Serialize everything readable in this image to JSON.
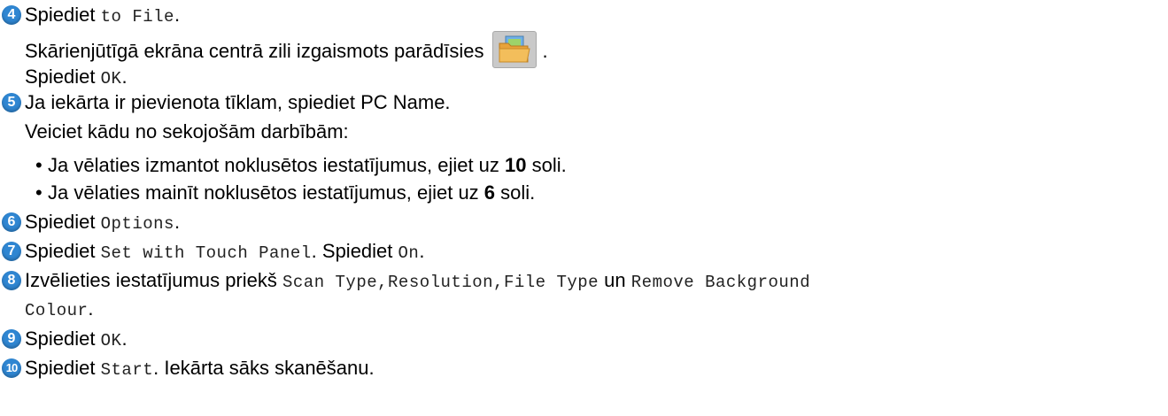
{
  "steps": [
    {
      "num": "4",
      "pre": "Spiediet ",
      "code": "to File",
      "post": "."
    },
    {
      "line2": "Skārienjūtīgā ekrāna centrā zili izgaismots parādīsies",
      "line2_end": ".",
      "icon": "folder-photo-icon"
    },
    {
      "line3_pre": "Spiediet ",
      "line3_code": "OK",
      "line3_post": "."
    }
  ],
  "step4": {
    "num": "4",
    "pre": "Spiediet ",
    "code": "to File",
    "post": ".",
    "line2": "Skārienjūtīgā ekrāna centrā zili izgaismots parādīsies",
    "line2_end": ".",
    "line3_pre": "Spiediet ",
    "line3_code": "OK",
    "line3_post": "."
  },
  "step5": {
    "num": "5",
    "text": "Ja iekārta ir pievienota tīklam, spiediet PC Name.",
    "line2": "Veiciet kādu no sekojošām darbībām:",
    "bullet1_pre": "Ja vēlaties izmantot noklusētos iestatījumus, ejiet uz ",
    "bullet1_bold": "10",
    "bullet1_post": " soli.",
    "bullet2_pre": "Ja vēlaties mainīt noklusētos iestatījumus, ejiet uz ",
    "bullet2_bold": "6",
    "bullet2_post": " soli."
  },
  "step6": {
    "num": "6",
    "pre": "Spiediet ",
    "code": "Options",
    "post": "."
  },
  "step7": {
    "num": "7",
    "pre": "Spiediet ",
    "code": "Set with Touch Panel",
    "mid": ". Spiediet ",
    "code2": "On",
    "post": "."
  },
  "step8": {
    "num": "8",
    "pre": "Izvēlieties iestatījumus priekš ",
    "code": "Scan Type,Resolution,File Type",
    "mid": " un ",
    "code2": "Remove Background",
    "cont": "Colour",
    "post": "."
  },
  "step9": {
    "num": "9",
    "pre": "Spiediet ",
    "code": "OK",
    "post": "."
  },
  "step10": {
    "num": "10",
    "pre": "Spiediet ",
    "code": "Start",
    "post": ". Iekārta sāks skanēšanu."
  },
  "colors": {
    "step_badge": "#2f86d2"
  }
}
